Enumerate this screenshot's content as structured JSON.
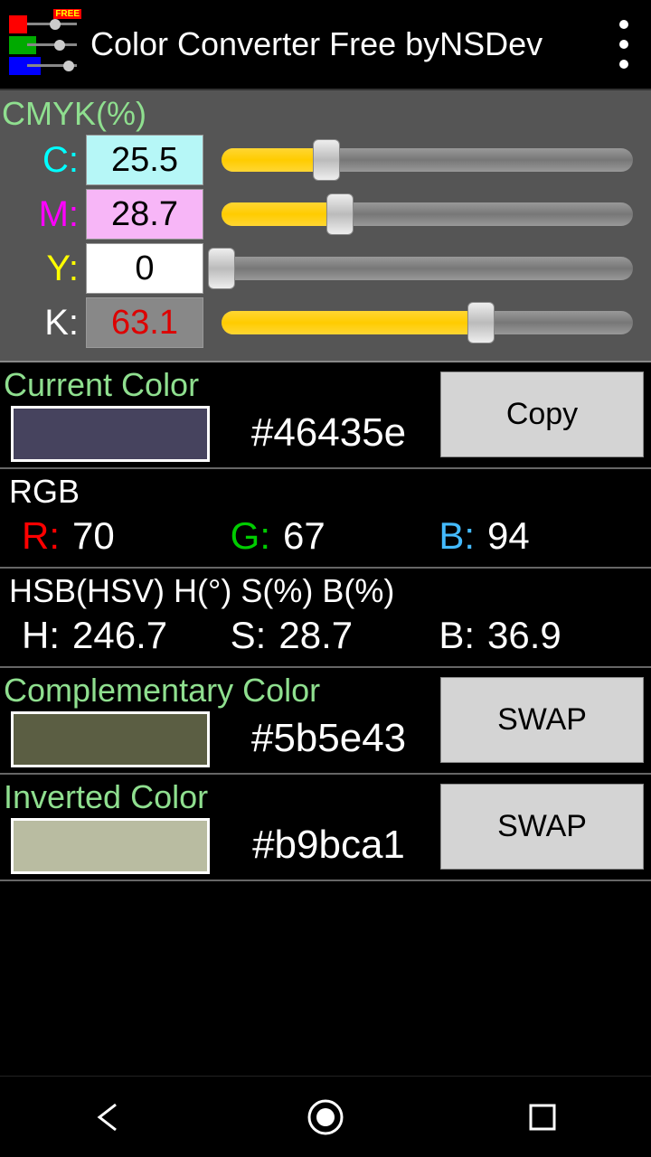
{
  "header": {
    "title": "Color Converter Free byNSDev",
    "free_badge": "FREE"
  },
  "cmyk": {
    "title": "CMYK(%)",
    "labels": {
      "c": "C:",
      "m": "M:",
      "y": "Y:",
      "k": "K:"
    },
    "values": {
      "c": "25.5",
      "m": "28.7",
      "y": "0",
      "k": "63.1"
    },
    "percents": {
      "c": 25.5,
      "m": 28.7,
      "y": 0,
      "k": 63.1
    }
  },
  "current": {
    "title": "Current Color",
    "hex": "#46435e",
    "swatch": "#46435e",
    "button": "Copy"
  },
  "rgb": {
    "title": "RGB",
    "labels": {
      "r": "R:",
      "g": "G:",
      "b": "B:"
    },
    "values": {
      "r": "70",
      "g": "67",
      "b": "94"
    }
  },
  "hsb": {
    "title": "HSB(HSV) H(°) S(%) B(%)",
    "labels": {
      "h": "H:",
      "s": "S:",
      "b": "B:"
    },
    "values": {
      "h": "246.7",
      "s": "28.7",
      "b": "36.9"
    }
  },
  "complementary": {
    "title": "Complementary Color",
    "hex": "#5b5e43",
    "swatch": "#5b5e43",
    "button": "SWAP"
  },
  "inverted": {
    "title": "Inverted Color",
    "hex": "#b9bca1",
    "swatch": "#b9bca1",
    "button": "SWAP"
  }
}
